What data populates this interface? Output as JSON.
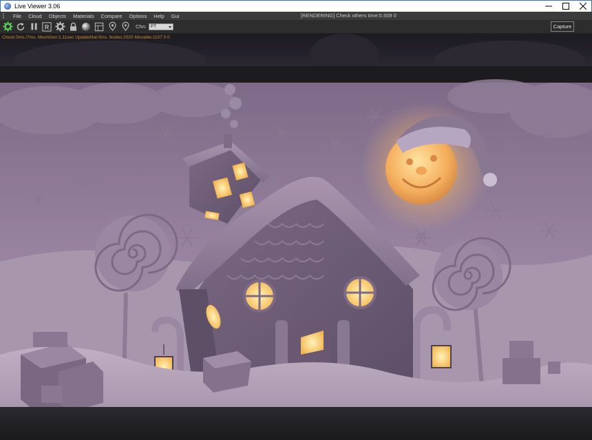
{
  "window": {
    "title": "Live Viewer 3.06"
  },
  "menu": {
    "items": [
      "File",
      "Cloud",
      "Objects",
      "Materials",
      "Compare",
      "Options",
      "Help",
      "Gui"
    ],
    "status": "[RENDERING] Check others time:5.509  0"
  },
  "toolbar": {
    "channel_label": "Chn:",
    "channel_value": "PT",
    "capture_label": "Capture"
  },
  "viewport": {
    "render_info": "Check:5ms./7ms. MeshGen:1.11sec UpdateMat:0ms. Nodes:2020 Movable:1107  0 0"
  },
  "colors": {
    "accent_green": "#5bd15b",
    "render_info": "#c98a3a",
    "scene_bg": "#8e7a98",
    "glow": "#ffd27a"
  }
}
